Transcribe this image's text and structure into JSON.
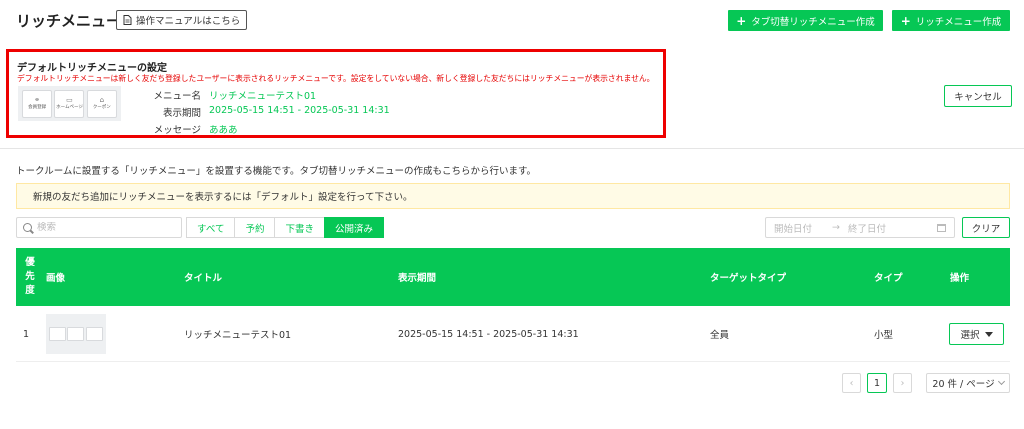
{
  "header": {
    "title": "リッチメニュー",
    "manual_label": "操作マニュアルはこちら",
    "tab_switch_create_label": "タブ切替リッチメニュー作成",
    "create_label": "リッチメニュー作成"
  },
  "default_setting": {
    "title": "デフォルトリッチメニューの設定",
    "description": "デフォルトリッチメニューは新しく友だち登録したユーザーに表示されるリッチメニューです。設定をしていない場合、新しく登録した友だちにはリッチメニューが表示されません。",
    "thumbnail_cells": [
      "会員登録",
      "ホームページ",
      "クーポン"
    ],
    "menu_name_label": "メニュー名",
    "menu_name_value": "リッチメニューテスト01",
    "period_label": "表示期間",
    "period_value": "2025-05-15 14:51 - 2025-05-31 14:31",
    "message_label": "メッセージ",
    "message_value": "あああ",
    "cancel_label": "キャンセル"
  },
  "description": "トークルームに設置する「リッチメニュー」を設置する機能です。タブ切替リッチメニューの作成もこちらから行います。",
  "notice": "新規の友だち追加にリッチメニューを表示するには「デフォルト」設定を行って下さい。",
  "filters": {
    "search_placeholder": "検索",
    "tabs": [
      "すべて",
      "予約",
      "下書き",
      "公開済み"
    ],
    "active_tab": "公開済み",
    "start_date_placeholder": "開始日付",
    "end_date_placeholder": "終了日付",
    "clear_label": "クリア"
  },
  "table": {
    "columns": {
      "priority": [
        "優",
        "先",
        "度"
      ],
      "image": "画像",
      "title": "タイトル",
      "period": "表示期間",
      "target_type": "ターゲットタイプ",
      "type": "タイプ",
      "actions": "操作"
    },
    "rows": [
      {
        "priority": "1",
        "title": "リッチメニューテスト01",
        "period": "2025-05-15 14:51 - 2025-05-31 14:31",
        "target_type": "全員",
        "type": "小型",
        "action_label": "選択"
      }
    ]
  },
  "pagination": {
    "current_page": "1",
    "page_size_label": "20 件 / ページ"
  },
  "colors": {
    "accent": "#06c755",
    "highlight_border": "#ee0000",
    "notice_bg": "#fffbe6"
  }
}
